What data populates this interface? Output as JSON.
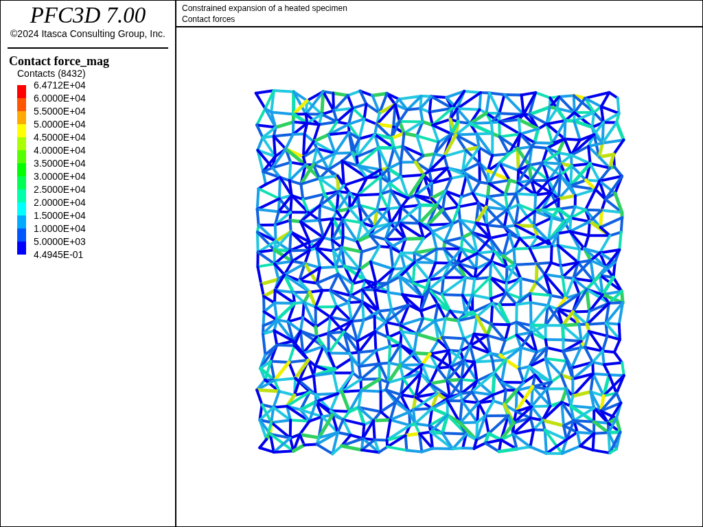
{
  "header": {
    "product": "PFC3D 7.00",
    "copyright": "©2024 Itasca Consulting Group, Inc."
  },
  "legend": {
    "title": "Contact force_mag",
    "subtitle": "Contacts (8432)",
    "labels": [
      "6.4712E+04",
      "6.0000E+04",
      "5.5000E+04",
      "5.0000E+04",
      "4.5000E+04",
      "4.0000E+04",
      "3.5000E+04",
      "3.0000E+04",
      "2.5000E+04",
      "2.0000E+04",
      "1.5000E+04",
      "1.0000E+04",
      "5.0000E+03",
      "4.4945E-01"
    ],
    "bands": [
      {
        "color": "#ff0000"
      },
      {
        "color": "#ff5500"
      },
      {
        "color": "#ffaa00"
      },
      {
        "color": "#ffff00"
      },
      {
        "color": "#aaff00"
      },
      {
        "color": "#55ff00"
      },
      {
        "color": "#00ff00"
      },
      {
        "color": "#00ff55"
      },
      {
        "color": "#00ffaa"
      },
      {
        "color": "#00ffff"
      },
      {
        "color": "#00aaff"
      },
      {
        "color": "#0055ff"
      },
      {
        "color": "#0000ff"
      }
    ]
  },
  "plot": {
    "title_lines": [
      "Constrained expansion of a heated specimen",
      "Contact forces"
    ]
  }
}
